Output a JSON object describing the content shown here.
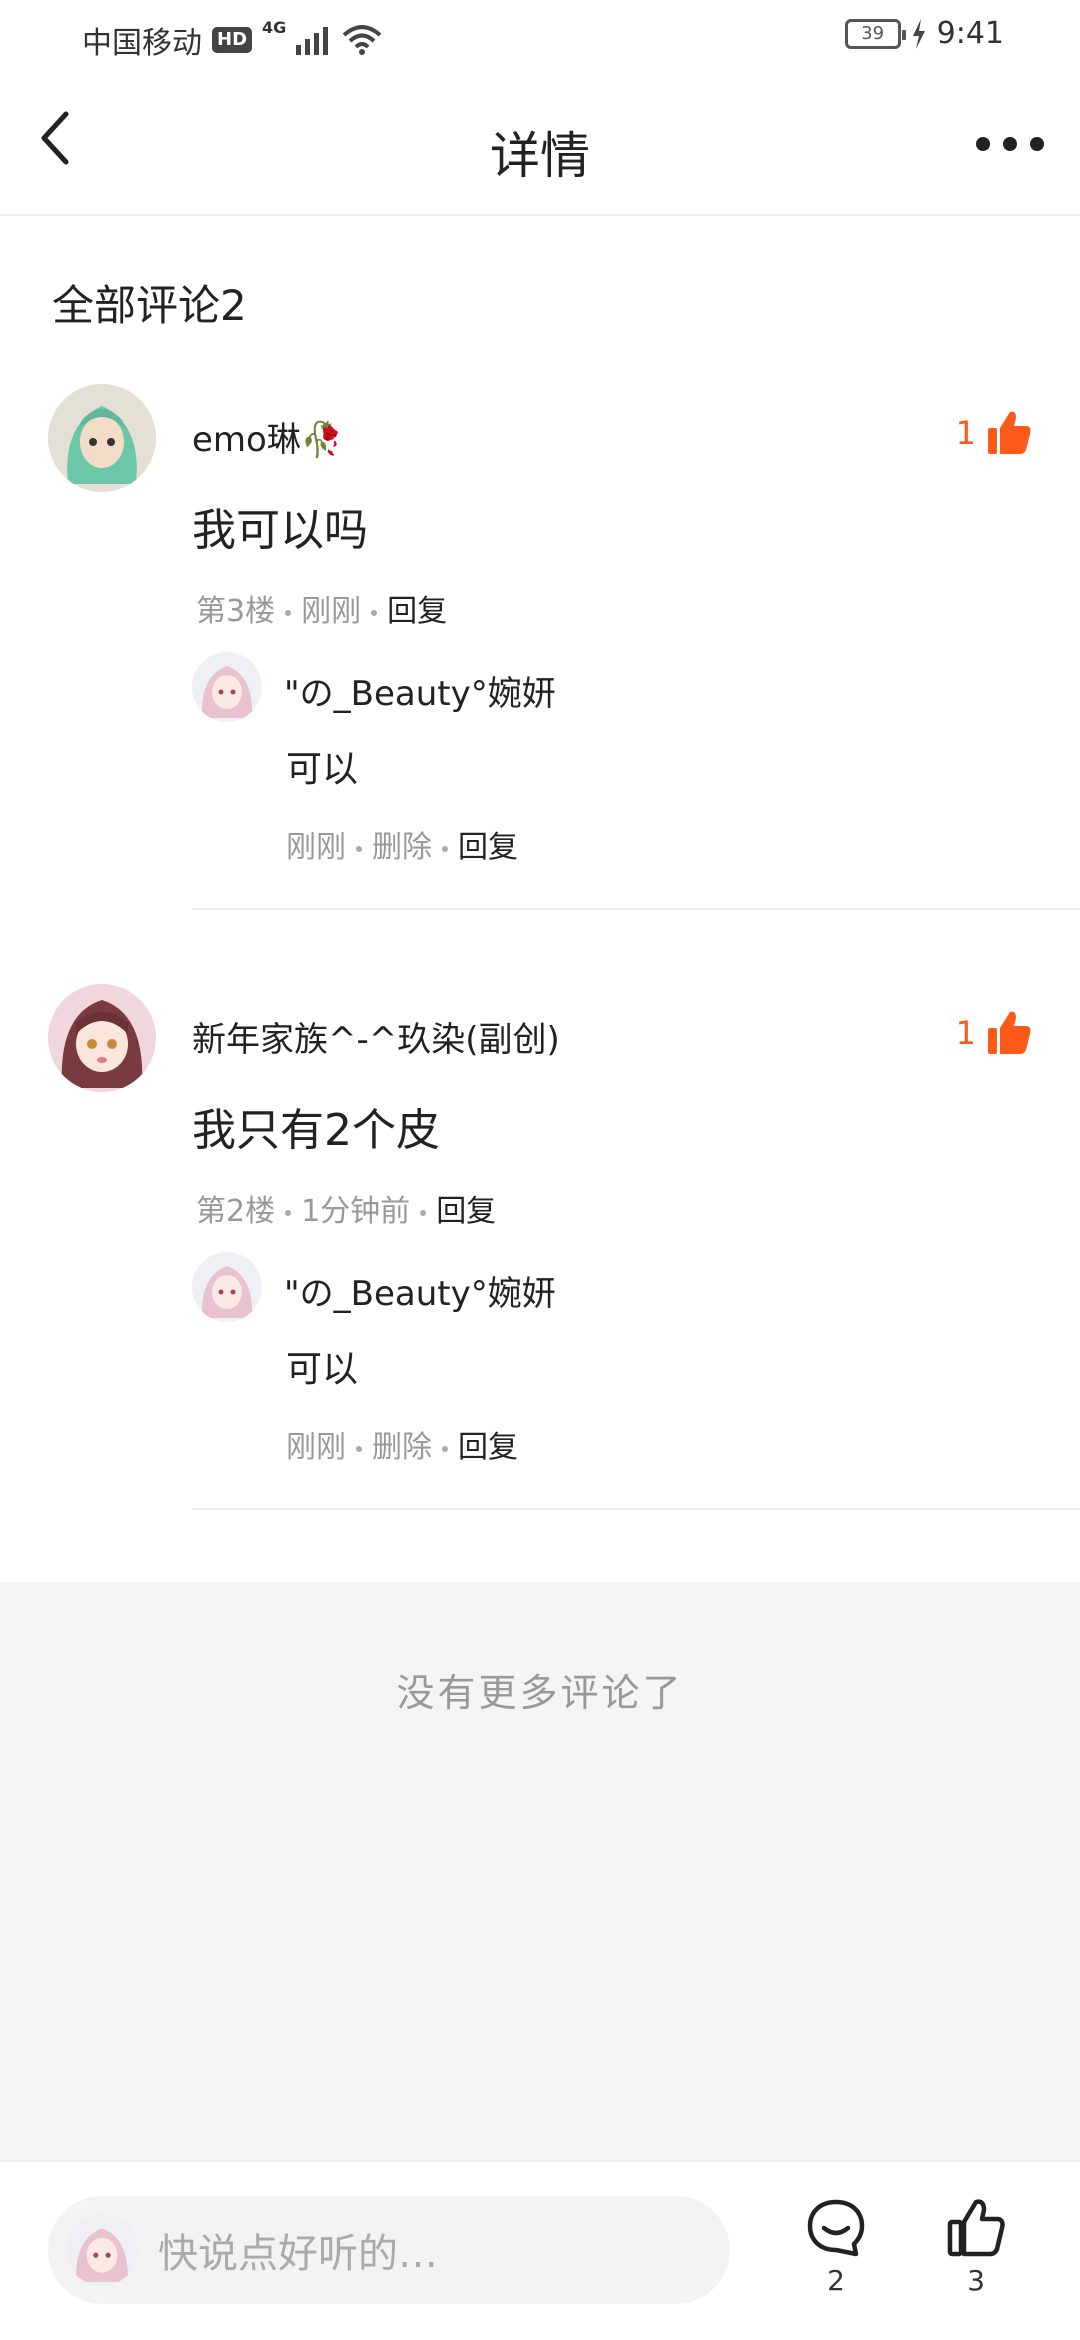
{
  "status_bar": {
    "carrier": "中国移动",
    "hd": "HD",
    "network": "4G",
    "battery": "39",
    "time": "9:41"
  },
  "header": {
    "title": "详情"
  },
  "section": {
    "title": "全部评论2"
  },
  "comments": [
    {
      "name": "emo琳🥀",
      "likes": "1",
      "text": "我可以吗",
      "floor": "第3楼",
      "time": "刚刚",
      "reply_label": "回复",
      "reply": {
        "name": "\"の_Beauty°婉妍",
        "text": "可以",
        "time": "刚刚",
        "delete_label": "删除",
        "reply_label": "回复"
      }
    },
    {
      "name": "新年家族^-^玖染(副创)",
      "likes": "1",
      "text": "我只有2个皮",
      "floor": "第2楼",
      "time": "1分钟前",
      "reply_label": "回复",
      "reply": {
        "name": "\"の_Beauty°婉妍",
        "text": "可以",
        "time": "刚刚",
        "delete_label": "删除",
        "reply_label": "回复"
      }
    }
  ],
  "footer": {
    "no_more": "没有更多评论了"
  },
  "bottom_bar": {
    "placeholder": "快说点好听的…",
    "comment_count": "2",
    "like_count": "3"
  },
  "colors": {
    "accent": "#ff5a1a",
    "meta": "#999999",
    "divider": "#ececec",
    "panel": "#f5f5f5"
  },
  "icons": [
    "back-arrow-icon",
    "more-dots-icon",
    "thumbs-up-icon",
    "comment-bubble-icon",
    "wifi-icon",
    "signal-icon",
    "battery-icon",
    "charging-icon"
  ]
}
